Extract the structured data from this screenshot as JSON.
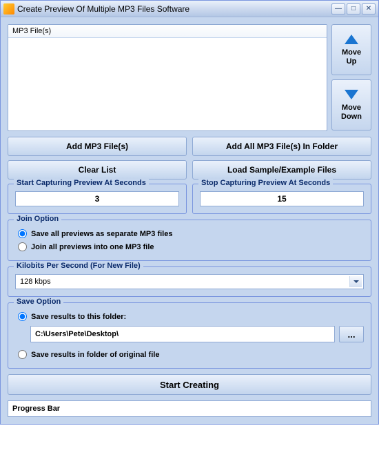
{
  "title": "Create Preview Of Multiple MP3 Files Software",
  "list_header": "MP3 File(s)",
  "move_up": "Move\nUp",
  "move_down": "Move\nDown",
  "buttons": {
    "add_files": "Add MP3 File(s)",
    "add_folder": "Add All MP3 File(s) In Folder",
    "clear": "Clear List",
    "load_sample": "Load Sample/Example Files"
  },
  "start_capture": {
    "legend": "Start Capturing Preview At Seconds",
    "value": "3"
  },
  "stop_capture": {
    "legend": "Stop Capturing Preview At Seconds",
    "value": "15"
  },
  "join_option": {
    "legend": "Join Option",
    "opt1": "Save all previews as separate MP3 files",
    "opt2": "Join all previews into one MP3 file"
  },
  "kilobits": {
    "legend": "Kilobits Per Second (For New File)",
    "value": "128 kbps"
  },
  "save_option": {
    "legend": "Save Option",
    "opt1": "Save results to this folder:",
    "path": "C:\\Users\\Pete\\Desktop\\",
    "browse": "...",
    "opt2": "Save results in folder of original file"
  },
  "start": "Start Creating",
  "progress": "Progress Bar"
}
